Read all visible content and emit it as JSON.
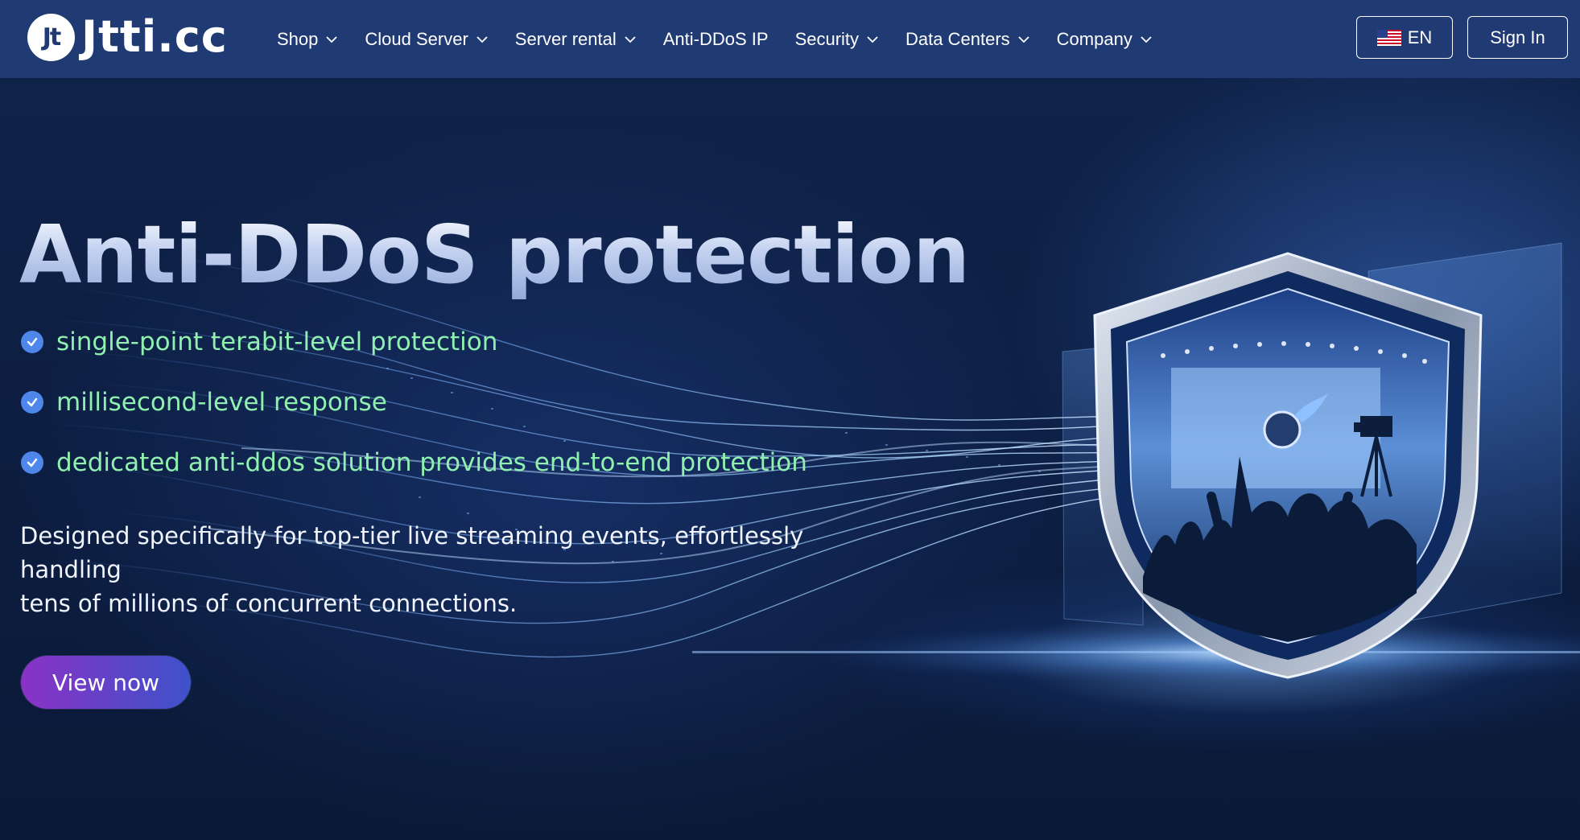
{
  "nav": {
    "logo_mark": "Jt",
    "logo_text": "Jtti.cc",
    "items": [
      {
        "label": "Shop",
        "has_dropdown": true
      },
      {
        "label": "Cloud Server",
        "has_dropdown": true
      },
      {
        "label": "Server rental",
        "has_dropdown": true
      },
      {
        "label": "Anti-DDoS IP",
        "has_dropdown": false
      },
      {
        "label": "Security",
        "has_dropdown": true
      },
      {
        "label": "Data Centers",
        "has_dropdown": true
      },
      {
        "label": "Company",
        "has_dropdown": true
      }
    ],
    "language": {
      "label": "EN",
      "flag_icon": "us-flag-icon"
    },
    "signin_label": "Sign In"
  },
  "hero": {
    "title": "Anti-DDoS protection",
    "features": [
      "single-point terabit-level protection",
      "millisecond-level response",
      "dedicated anti-ddos solution provides end-to-end protection"
    ],
    "description_line1": "Designed specifically for top-tier live streaming events, effortlessly handling",
    "description_line2": "tens of millions of concurrent connections.",
    "cta_label": "View now"
  },
  "colors": {
    "navbar": "#203a73",
    "hero_background": "#0c1d40",
    "feature_text": "#8ff0b0",
    "check_icon": "#4f86ea",
    "cta_gradient_start": "#8a32c6",
    "cta_gradient_end": "#3d52c9"
  },
  "illustration": {
    "icon": "shield-with-stadium-crowd-icon"
  }
}
